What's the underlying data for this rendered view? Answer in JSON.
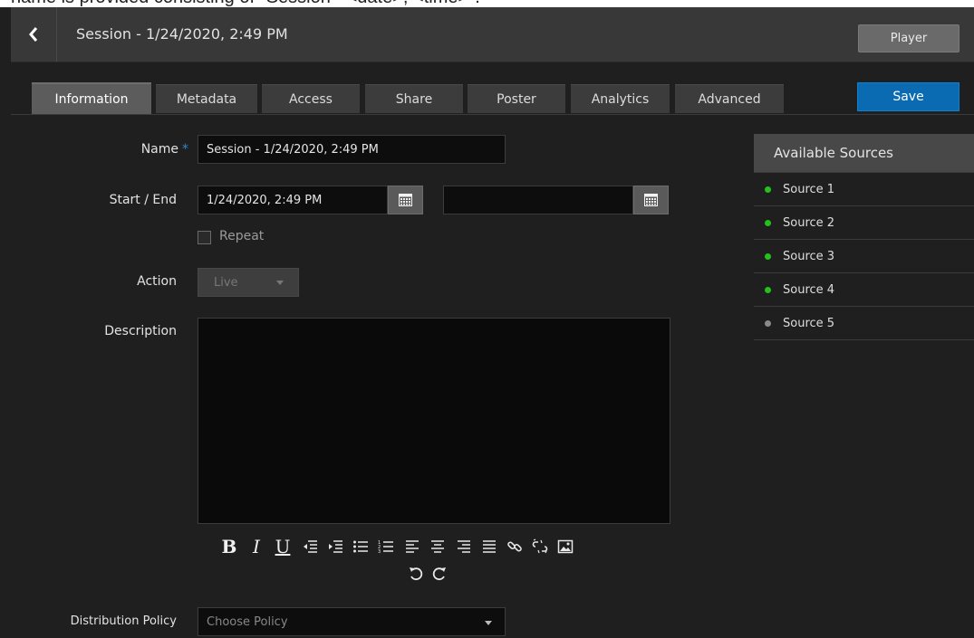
{
  "doc_caption": "name is provided consisting of \"Session - <date>, <time>\".",
  "header": {
    "title": "Session - 1/24/2020, 2:49 PM",
    "player_label": "Player"
  },
  "tabs": [
    {
      "label": "Information",
      "active": true
    },
    {
      "label": "Metadata"
    },
    {
      "label": "Access"
    },
    {
      "label": "Share"
    },
    {
      "label": "Poster"
    },
    {
      "label": "Analytics"
    },
    {
      "label": "Advanced"
    }
  ],
  "save_label": "Save",
  "form": {
    "name_label": "Name",
    "name_required": "*",
    "name_value": "Session - 1/24/2020, 2:49 PM",
    "start_end_label": "Start / End",
    "start_value": "1/24/2020, 2:49 PM",
    "end_value": "",
    "repeat_label": "Repeat",
    "action_label": "Action",
    "action_value": "Live",
    "description_label": "Description",
    "description_value": "",
    "distribution_label": "Distribution Policy",
    "distribution_placeholder": "Choose Policy"
  },
  "editor_toolbar": [
    "bold-icon",
    "italic-icon",
    "underline-icon",
    "outdent-icon",
    "indent-icon",
    "bullet-list-icon",
    "numbered-list-icon",
    "align-left-icon",
    "align-center-icon",
    "align-right-icon",
    "align-justify-icon",
    "link-icon",
    "unlink-icon",
    "image-icon",
    "undo-icon",
    "redo-icon"
  ],
  "sources": {
    "header": "Available Sources",
    "items": [
      {
        "label": "Source 1",
        "status_color": "#22c21a"
      },
      {
        "label": "Source 2",
        "status_color": "#22c21a"
      },
      {
        "label": "Source 3",
        "status_color": "#22c21a"
      },
      {
        "label": "Source 4",
        "status_color": "#22c21a"
      },
      {
        "label": "Source 5",
        "status_color": "#8a8a8a"
      }
    ]
  },
  "colors": {
    "accent": "#0a6bb2",
    "required_star": "#2f88cf"
  }
}
